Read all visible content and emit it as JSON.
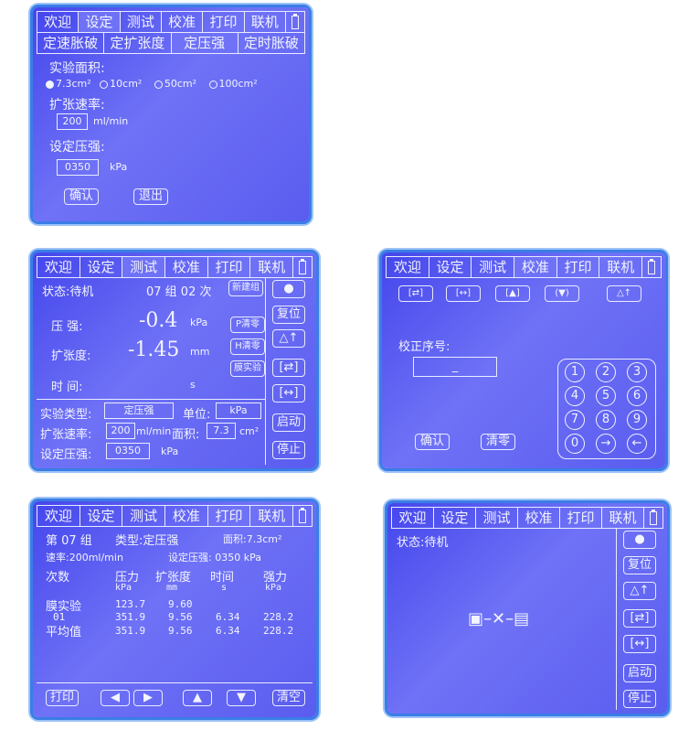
{
  "tabs": {
    "welcome": "欢迎",
    "setup": "设定",
    "test": "测试",
    "calibrate": "校准",
    "print": "打印",
    "online": "联机"
  },
  "screen1": {
    "subtabs": [
      "定速胀破",
      "定扩张度",
      "定压强",
      "定时胀破"
    ],
    "area_label": "实验面积:",
    "area_options": [
      "7.3cm²",
      "10cm²",
      "50cm²",
      "100cm²"
    ],
    "area_selected": 0,
    "rate_label": "扩张速率:",
    "rate_value": "200",
    "rate_unit": "ml/min",
    "pressure_label": "设定压强:",
    "pressure_value": "0350",
    "pressure_unit": "kPa",
    "confirm": "确认",
    "exit": "退出"
  },
  "screen2": {
    "status": "状态:待机",
    "group": "07 组 02 次",
    "new_group": "新建组",
    "pressure_label": "压  强:",
    "pressure_value": "-0.4",
    "pressure_unit": "kPa",
    "p_zero": "P清零",
    "expansion_label": "扩张度:",
    "expansion_value": "-1.45",
    "expansion_unit": "mm",
    "h_zero": "H清零",
    "membrane": "膜实验",
    "time_label": "时  间:",
    "time_unit": "s",
    "type_label": "实验类型:",
    "type_value": "定压强",
    "unit_label": "单位:",
    "unit_value": "kPa",
    "rate_label": "扩张速率:",
    "rate_value": "200",
    "rate_unit": "ml/min",
    "area_label": "面积:",
    "area_value": "7.3",
    "area_unit": "cm²",
    "set_pressure_label": "设定压强:",
    "set_pressure_value": "0350",
    "set_pressure_unit": "kPa",
    "reset": "复位",
    "start": "启动",
    "stop": "停止"
  },
  "screen3": {
    "seq_label": "校正序号:",
    "seq_value": "_",
    "keys": [
      "1",
      "2",
      "3",
      "4",
      "5",
      "6",
      "7",
      "8",
      "9",
      "0",
      "→",
      "←"
    ],
    "confirm": "确认",
    "clear": "清零"
  },
  "screen4": {
    "line1_group": "第 07 组",
    "line1_type": "类型:定压强",
    "line1_area": "面积:7.3cm²",
    "line2_rate": "速率:200ml/min",
    "line2_set": "设定压强: 0350 kPa",
    "headers": [
      "次数",
      "压力",
      "扩张度",
      "时间",
      "强力"
    ],
    "units": [
      "",
      "kPa",
      "mm",
      "s",
      "kPa"
    ],
    "rows": [
      [
        "膜实验",
        "123.7",
        "9.60",
        "",
        ""
      ],
      [
        "01",
        "351.9",
        "9.56",
        "6.34",
        "228.2"
      ],
      [
        "平均值",
        "351.9",
        "9.56",
        "6.34",
        "228.2"
      ]
    ],
    "print": "打印",
    "clear": "清空"
  },
  "screen5": {
    "status": "状态:待机",
    "reset": "复位",
    "start": "启动",
    "stop": "停止"
  },
  "colors": {
    "screen": "#5a5cef",
    "frame": "#3a7de6",
    "text": "#f2f4ff"
  }
}
